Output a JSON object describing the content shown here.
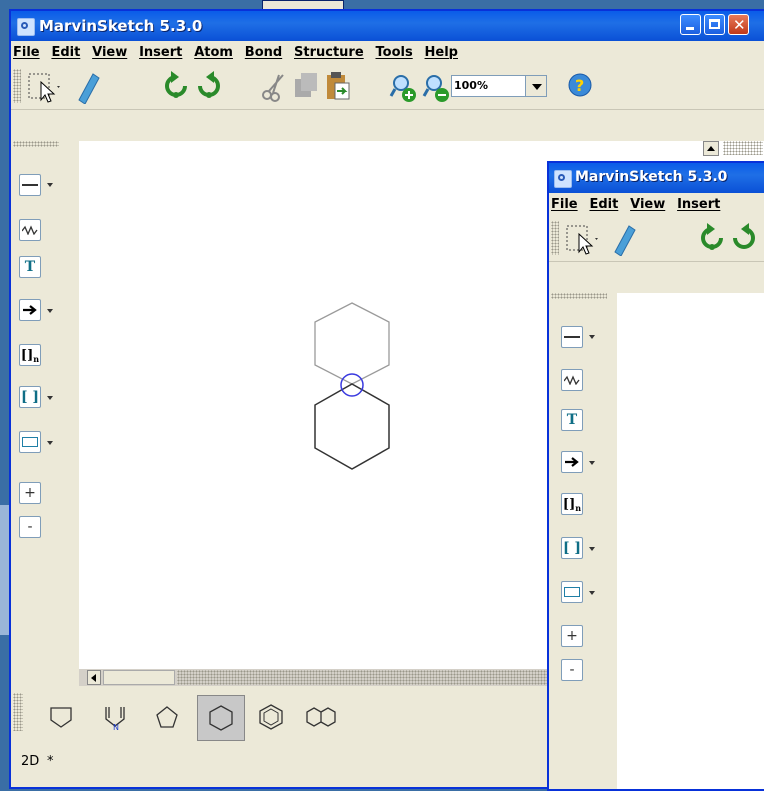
{
  "window_main": {
    "title": "MarvinSketch 5.3.0",
    "menus": [
      "File",
      "Edit",
      "View",
      "Insert",
      "Atom",
      "Bond",
      "Structure",
      "Tools",
      "Help"
    ],
    "zoom": "100%",
    "status_mode": "2D",
    "status_modified": "*"
  },
  "window_second": {
    "title": "MarvinSketch 5.3.0",
    "menus": [
      "File",
      "Edit",
      "View",
      "Insert"
    ]
  },
  "sidebar_tools": [
    {
      "icon": "single-bond-icon",
      "label": ""
    },
    {
      "icon": "wavy-bond-icon",
      "label": ""
    },
    {
      "icon": "text-tool-icon",
      "label": "T"
    },
    {
      "icon": "arrow-icon",
      "label": ""
    },
    {
      "icon": "repeating-unit-icon",
      "label": ""
    },
    {
      "icon": "bracket-icon",
      "label": "[ ]"
    },
    {
      "icon": "rectangle-icon",
      "label": ""
    },
    {
      "icon": "plus-charge-icon",
      "label": "+"
    },
    {
      "icon": "minus-charge-icon",
      "label": "-"
    }
  ],
  "templates": [
    "pentagon-house",
    "pyrrole",
    "cyclopentane",
    "cyclohexane",
    "benzene",
    "naphthalene"
  ],
  "colors": {
    "title_blue": "#0a5ce9",
    "selection_circle": "#3a3adf",
    "molecule_gray": "#9a9a9a",
    "molecule_black": "#333333"
  }
}
